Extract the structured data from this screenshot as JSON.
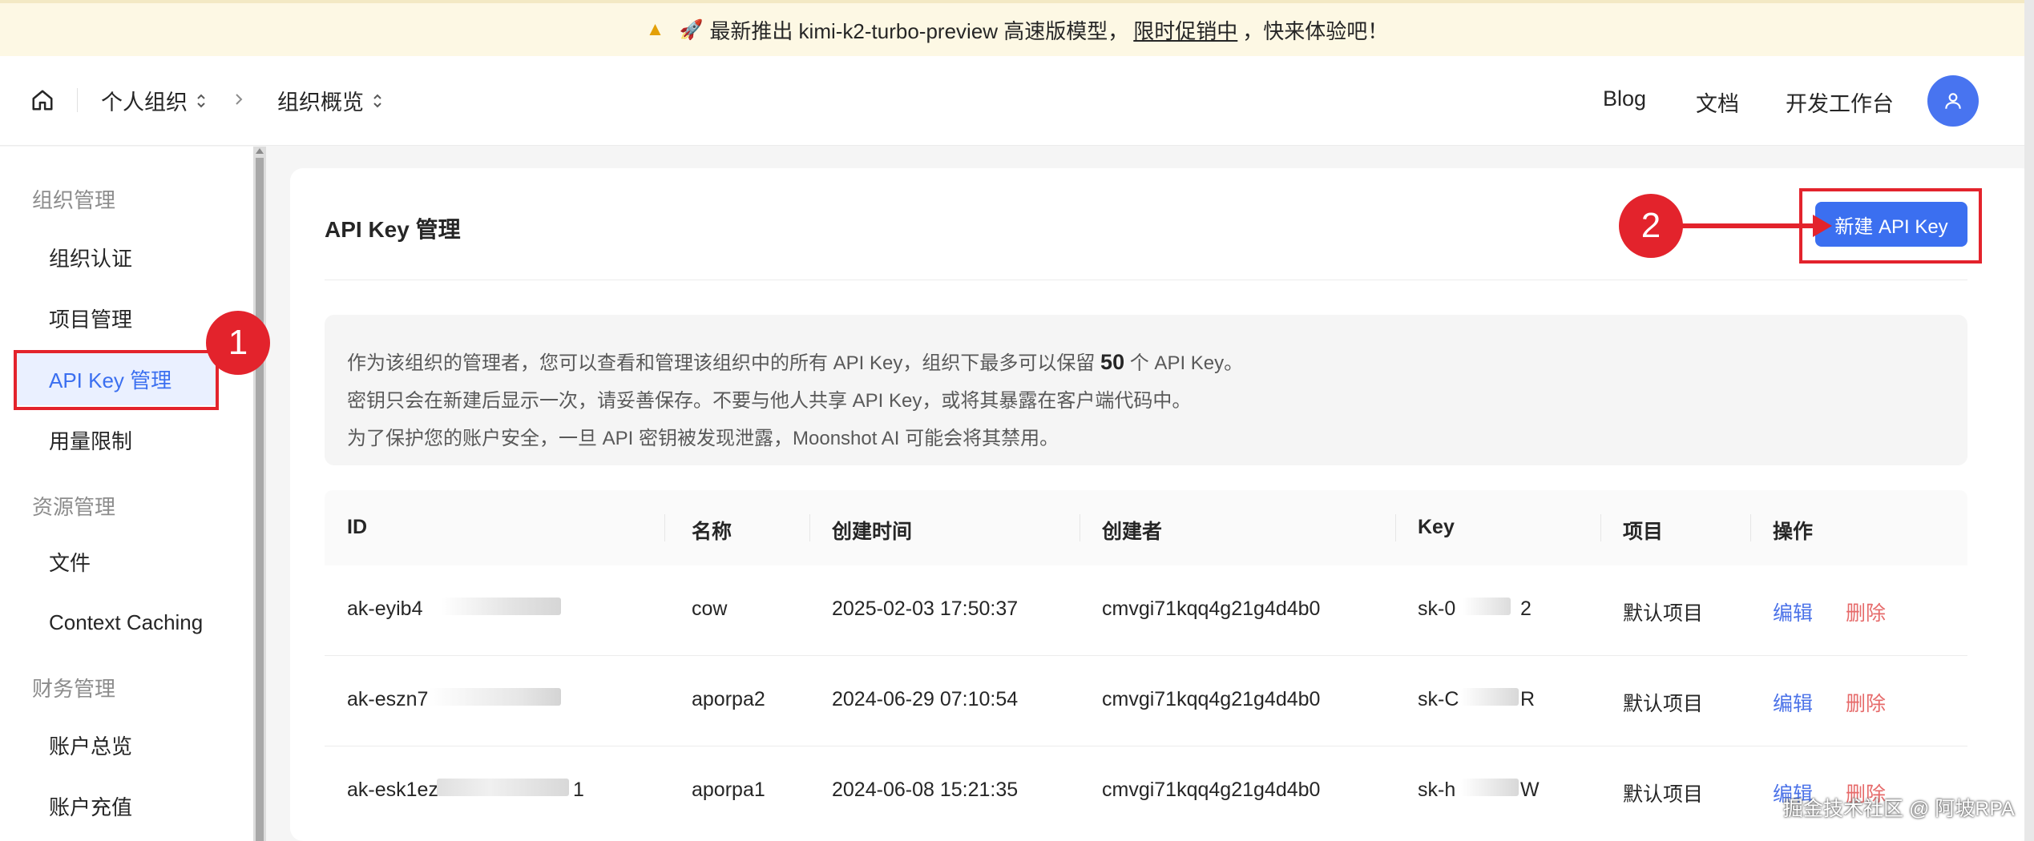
{
  "banner": {
    "text": "最新推出 kimi-k2-turbo-preview 高速版模型，",
    "link": "限时促销中",
    "suffix": "，快来体验吧！"
  },
  "topbar": {
    "org_label": "个人组织",
    "page_label": "组织概览",
    "nav": [
      "Blog",
      "文档",
      "开发工作台"
    ]
  },
  "sidebar": {
    "sections": [
      {
        "title": "组织管理",
        "items": [
          "组织认证",
          "项目管理",
          "API Key 管理",
          "用量限制"
        ]
      },
      {
        "title": "资源管理",
        "items": [
          "文件",
          "Context Caching"
        ]
      },
      {
        "title": "财务管理",
        "items": [
          "账户总览",
          "账户充值"
        ]
      }
    ],
    "active_item": "API Key 管理"
  },
  "main": {
    "title": "API Key 管理",
    "new_button": "新建 API Key",
    "info_line1_pre": "作为该组织的管理者，您可以查看和管理该组织中的所有 API Key，组织下最多可以保留",
    "info_line1_num": "50",
    "info_line1_post": "个 API Key。",
    "info_line2": "密钥只会在新建后显示一次，请妥善保存。不要与他人共享 API Key，或将其暴露在客户端代码中。",
    "info_line3": "为了保护您的账户安全，一旦 API 密钥被发现泄露，Moonshot AI 可能会将其禁用。"
  },
  "table": {
    "columns": [
      "ID",
      "名称",
      "创建时间",
      "创建者",
      "Key",
      "项目",
      "操作"
    ],
    "rows": [
      {
        "id": "ak-eyib4",
        "name": "cow",
        "created": "2025-02-03 17:50:37",
        "creator": "cmvgi71kqq4g21g4d4b0",
        "key": "sk-0",
        "key_tail": "2",
        "project": "默认项目",
        "edit": "编辑",
        "delete": "删除"
      },
      {
        "id": "ak-eszn7",
        "name": "aporpa2",
        "created": "2024-06-29 07:10:54",
        "creator": "cmvgi71kqq4g21g4d4b0",
        "key": "sk-C",
        "key_tail": "R",
        "project": "默认项目",
        "edit": "编辑",
        "delete": "删除"
      },
      {
        "id": "ak-esk1ez",
        "name": "aporpa1",
        "created": "2024-06-08 15:21:35",
        "creator": "cmvgi71kqq4g21g4d4b0",
        "key": "sk-h",
        "key_tail": "W",
        "project": "默认项目",
        "edit": "编辑",
        "delete": "删除"
      }
    ],
    "row3_id_tail": "1"
  },
  "annotations": {
    "step1": "1",
    "step2": "2",
    "color": "#e3232c"
  },
  "watermark": "掘金技术社区 @ 阿坡RPA",
  "colors": {
    "accent": "#3b6ff0",
    "danger": "#e66a6a",
    "banner_bg": "#fdf8e4"
  },
  "icons": [
    "warning-icon",
    "rocket-icon",
    "home-icon",
    "chevron-updown-icon",
    "chevron-right-icon",
    "user-icon"
  ]
}
